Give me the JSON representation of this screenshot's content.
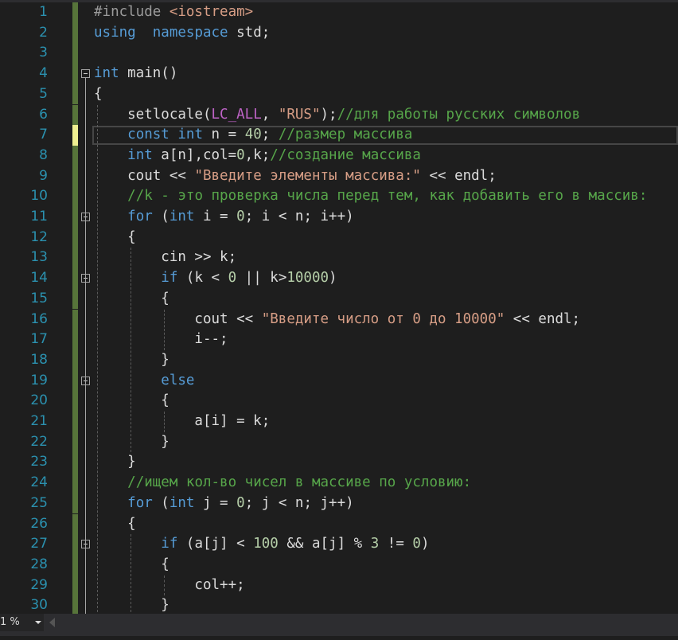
{
  "editor": {
    "lines": [
      {
        "n": "1",
        "tokens": [
          [
            "pp",
            "#include "
          ],
          [
            "inc",
            "<iostream>"
          ]
        ]
      },
      {
        "n": "2",
        "tokens": [
          [
            "kw",
            "using"
          ],
          [
            "",
            "  "
          ],
          [
            "kw",
            "namespace"
          ],
          [
            "",
            " std;"
          ]
        ]
      },
      {
        "n": "3",
        "tokens": []
      },
      {
        "n": "4",
        "tokens": [
          [
            "kw",
            "int"
          ],
          [
            "",
            " main()"
          ]
        ]
      },
      {
        "n": "5",
        "tokens": [
          [
            "",
            "{"
          ]
        ]
      },
      {
        "n": "6",
        "tokens": [
          [
            "",
            "    setlocale("
          ],
          [
            "mac",
            "LC_ALL"
          ],
          [
            "",
            ", "
          ],
          [
            "str",
            "\"RUS\""
          ],
          [
            "",
            ");"
          ],
          [
            "cm",
            "//для работы русских символов"
          ]
        ]
      },
      {
        "n": "7",
        "tokens": [
          [
            "",
            "    "
          ],
          [
            "kw",
            "const"
          ],
          [
            "",
            " "
          ],
          [
            "kw",
            "int"
          ],
          [
            "",
            " n = "
          ],
          [
            "num",
            "40"
          ],
          [
            "",
            "; "
          ],
          [
            "cm",
            "//размер массива"
          ]
        ]
      },
      {
        "n": "8",
        "tokens": [
          [
            "",
            "    "
          ],
          [
            "kw",
            "int"
          ],
          [
            "",
            " a[n],col="
          ],
          [
            "num",
            "0"
          ],
          [
            "",
            ",k;"
          ],
          [
            "cm",
            "//создание массива"
          ]
        ]
      },
      {
        "n": "9",
        "tokens": [
          [
            "",
            "    cout << "
          ],
          [
            "str",
            "\"Введите элементы массива:\""
          ],
          [
            "",
            " << endl;"
          ]
        ]
      },
      {
        "n": "10",
        "tokens": [
          [
            "",
            "    "
          ],
          [
            "cm",
            "//k - это проверка числа перед тем, как добавить его в массив:"
          ]
        ]
      },
      {
        "n": "11",
        "tokens": [
          [
            "",
            "    "
          ],
          [
            "kw",
            "for"
          ],
          [
            "",
            " ("
          ],
          [
            "kw",
            "int"
          ],
          [
            "",
            " i = "
          ],
          [
            "num",
            "0"
          ],
          [
            "",
            "; i < n; i++)"
          ]
        ]
      },
      {
        "n": "12",
        "tokens": [
          [
            "",
            "    {"
          ]
        ]
      },
      {
        "n": "13",
        "tokens": [
          [
            "",
            "        cin >> k;"
          ]
        ]
      },
      {
        "n": "14",
        "tokens": [
          [
            "",
            "        "
          ],
          [
            "kw",
            "if"
          ],
          [
            "",
            " (k < "
          ],
          [
            "num",
            "0"
          ],
          [
            "",
            " || k>"
          ],
          [
            "num",
            "10000"
          ],
          [
            "",
            ")"
          ]
        ]
      },
      {
        "n": "15",
        "tokens": [
          [
            "",
            "        {"
          ]
        ]
      },
      {
        "n": "16",
        "tokens": [
          [
            "",
            "            cout << "
          ],
          [
            "str",
            "\"Введите число от 0 до 10000\""
          ],
          [
            "",
            " << endl;"
          ]
        ]
      },
      {
        "n": "17",
        "tokens": [
          [
            "",
            "            i--;"
          ]
        ]
      },
      {
        "n": "18",
        "tokens": [
          [
            "",
            "        }"
          ]
        ]
      },
      {
        "n": "19",
        "tokens": [
          [
            "",
            "        "
          ],
          [
            "kw",
            "else"
          ]
        ]
      },
      {
        "n": "20",
        "tokens": [
          [
            "",
            "        {"
          ]
        ]
      },
      {
        "n": "21",
        "tokens": [
          [
            "",
            "            a[i] = k;"
          ]
        ]
      },
      {
        "n": "22",
        "tokens": [
          [
            "",
            "        }"
          ]
        ]
      },
      {
        "n": "23",
        "tokens": [
          [
            "",
            "    }"
          ]
        ]
      },
      {
        "n": "24",
        "tokens": [
          [
            "",
            "    "
          ],
          [
            "cm",
            "//ищем кол-во чисел в массиве по условию:"
          ]
        ]
      },
      {
        "n": "25",
        "tokens": [
          [
            "",
            "    "
          ],
          [
            "kw",
            "for"
          ],
          [
            "",
            " ("
          ],
          [
            "kw",
            "int"
          ],
          [
            "",
            " j = "
          ],
          [
            "num",
            "0"
          ],
          [
            "",
            "; j < n; j++)"
          ]
        ]
      },
      {
        "n": "26",
        "tokens": [
          [
            "",
            "    {"
          ]
        ]
      },
      {
        "n": "27",
        "tokens": [
          [
            "",
            "        "
          ],
          [
            "kw",
            "if"
          ],
          [
            "",
            " (a[j] < "
          ],
          [
            "num",
            "100"
          ],
          [
            "",
            " && a[j] % "
          ],
          [
            "num",
            "3"
          ],
          [
            "",
            " != "
          ],
          [
            "num",
            "0"
          ],
          [
            "",
            ")"
          ]
        ]
      },
      {
        "n": "28",
        "tokens": [
          [
            "",
            "        {"
          ]
        ]
      },
      {
        "n": "29",
        "tokens": [
          [
            "",
            "            col++;"
          ]
        ]
      },
      {
        "n": "30",
        "tokens": [
          [
            "",
            "        }"
          ]
        ]
      }
    ],
    "modified_line": "7",
    "current_line": "7",
    "fold_lines": [
      "4",
      "11",
      "14",
      "19",
      "27"
    ]
  },
  "statusbar": {
    "zoom_value": "1 %"
  }
}
